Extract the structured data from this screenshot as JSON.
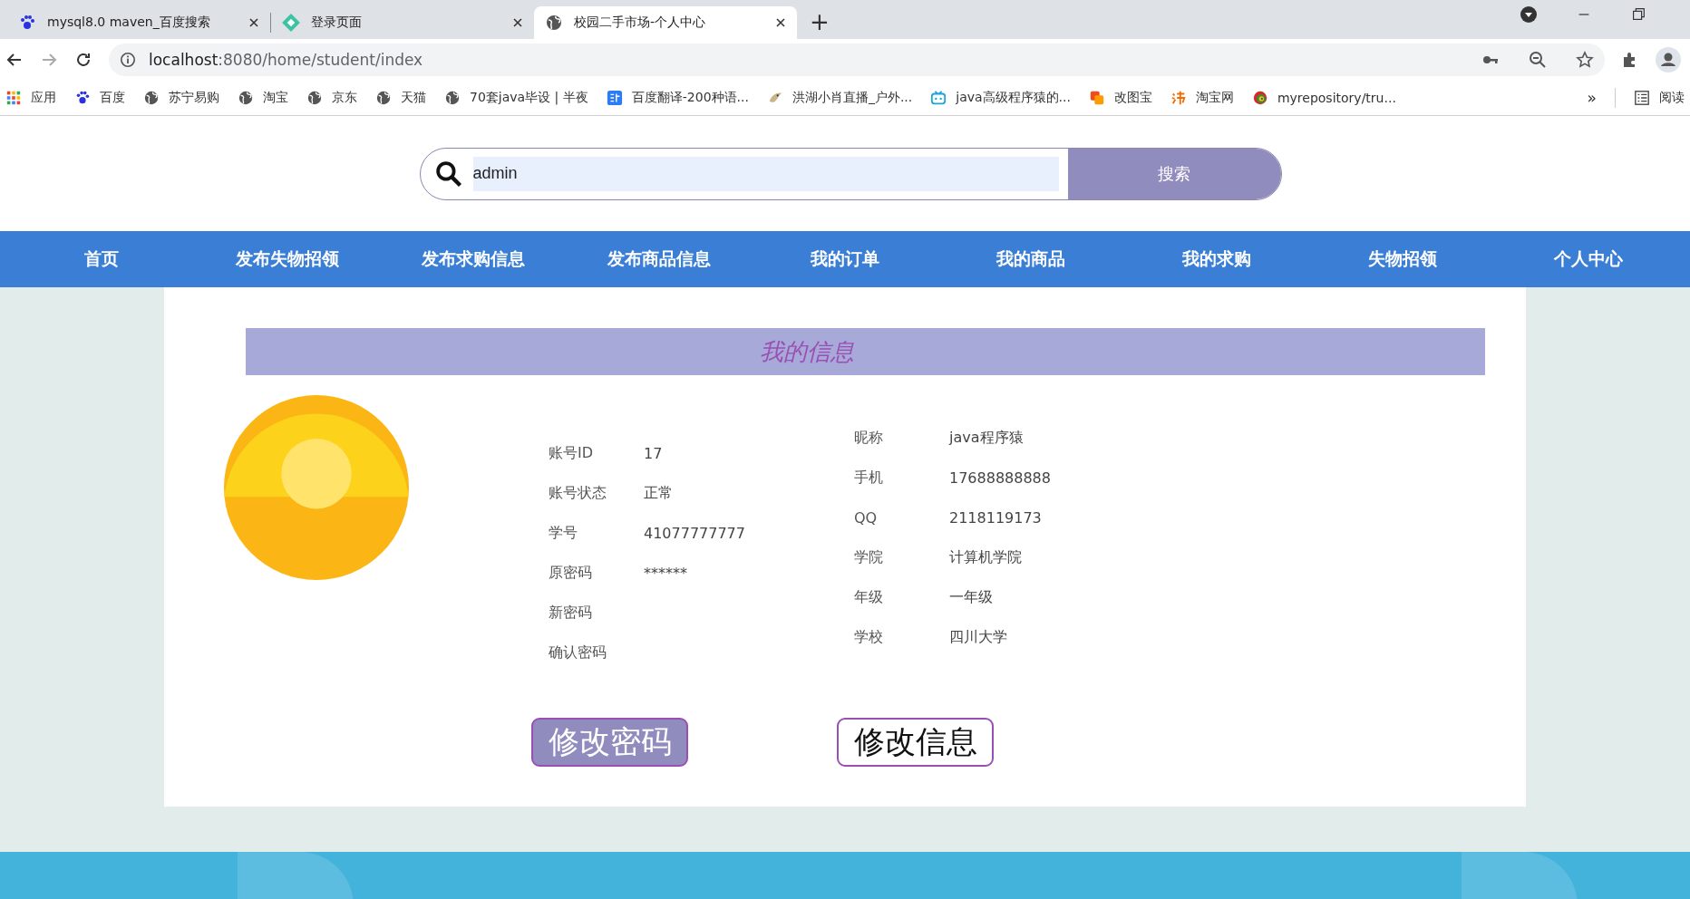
{
  "browser": {
    "tabs": [
      {
        "title": "mysql8.0 maven_百度搜索",
        "kind": "paw",
        "selected": false
      },
      {
        "title": "登录页面",
        "kind": "diamond",
        "selected": false
      },
      {
        "title": "校园二手市场-个人中心",
        "kind": "globe",
        "selected": true
      }
    ],
    "new_tab": "+",
    "address": {
      "host": "localhost",
      "rest": ":8080/home/student/index"
    },
    "bookmarks": [
      {
        "label": "应用",
        "kind": "apps"
      },
      {
        "label": "百度",
        "kind": "paw"
      },
      {
        "label": "苏宁易购",
        "kind": "globe"
      },
      {
        "label": "淘宝",
        "kind": "globe"
      },
      {
        "label": "京东",
        "kind": "globe"
      },
      {
        "label": "天猫",
        "kind": "globe"
      },
      {
        "label": "70套java毕设 | 半夜",
        "kind": "globe"
      },
      {
        "label": "百度翻译-200种语...",
        "kind": "translate"
      },
      {
        "label": "洪湖小肖直播_户外...",
        "kind": "bird"
      },
      {
        "label": "java高级程序猿的...",
        "kind": "tv"
      },
      {
        "label": "改图宝",
        "kind": "squares"
      },
      {
        "label": "淘宝网",
        "kind": "tao"
      },
      {
        "label": "myrepository/tru...",
        "kind": "swirl"
      }
    ],
    "overflow": "»",
    "reading_list": "阅读"
  },
  "search": {
    "value": "admin",
    "button": "搜索"
  },
  "nav": [
    {
      "label": "首页"
    },
    {
      "label": "发布失物招领"
    },
    {
      "label": "发布求购信息"
    },
    {
      "label": "发布商品信息"
    },
    {
      "label": "我的订单"
    },
    {
      "label": "我的商品"
    },
    {
      "label": "我的求购"
    },
    {
      "label": "失物招领"
    },
    {
      "label": "个人中心"
    }
  ],
  "section_title": "我的信息",
  "account_fields": [
    {
      "label": "账号ID",
      "value": "17"
    },
    {
      "label": "账号状态",
      "value": "正常"
    },
    {
      "label": "学号",
      "value": "41077777777"
    },
    {
      "label": "原密码",
      "value": "******"
    },
    {
      "label": "新密码"
    },
    {
      "label": "确认密码"
    }
  ],
  "profile_fields": [
    {
      "label": "昵称",
      "value": "java程序猿"
    },
    {
      "label": "手机",
      "value": "17688888888"
    },
    {
      "label": "QQ",
      "value": "2118119173"
    },
    {
      "label": "学院",
      "value": "计算机学院"
    },
    {
      "label": "年级",
      "value": "一年级"
    },
    {
      "label": "学校",
      "value": "四川大学"
    }
  ],
  "buttons": [
    {
      "label": "修改密码",
      "hovered": true
    },
    {
      "label": "修改信息",
      "hovered": false
    }
  ]
}
